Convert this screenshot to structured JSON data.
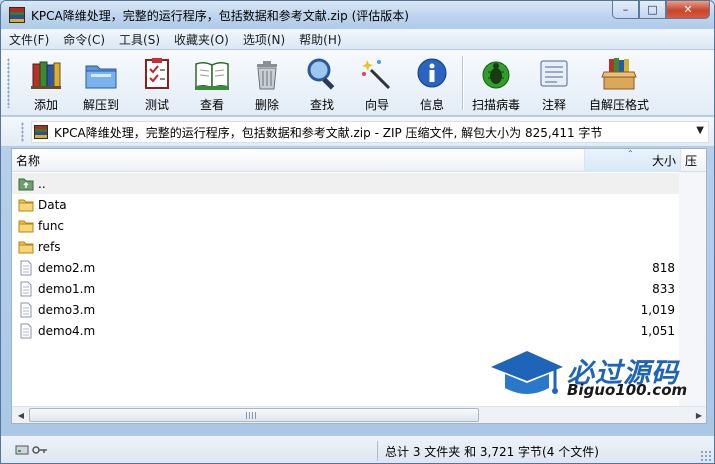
{
  "window": {
    "title": "KPCA降维处理，完整的运行程序，包括数据和参考文献.zip (评估版本)",
    "controls": {
      "minimize": "–",
      "maximize": "□",
      "close": "✕"
    }
  },
  "menu": [
    {
      "id": "file",
      "label": "文件(F)"
    },
    {
      "id": "commands",
      "label": "命令(C)"
    },
    {
      "id": "tools",
      "label": "工具(S)"
    },
    {
      "id": "favorites",
      "label": "收藏夹(O)"
    },
    {
      "id": "options",
      "label": "选项(N)"
    },
    {
      "id": "help",
      "label": "帮助(H)"
    }
  ],
  "toolbar": [
    {
      "id": "add",
      "label": "添加",
      "icon": "books-icon"
    },
    {
      "id": "extract-to",
      "label": "解压到",
      "icon": "folder-extract-icon"
    },
    {
      "id": "test",
      "label": "测试",
      "icon": "checklist-icon"
    },
    {
      "id": "view",
      "label": "查看",
      "icon": "open-book-icon"
    },
    {
      "id": "delete",
      "label": "删除",
      "icon": "trash-icon"
    },
    {
      "id": "find",
      "label": "查找",
      "icon": "magnifier-icon"
    },
    {
      "id": "wizard",
      "label": "向导",
      "icon": "magic-wand-icon"
    },
    {
      "id": "info",
      "label": "信息",
      "icon": "info-icon"
    },
    {
      "id": "virus-scan",
      "label": "扫描病毒",
      "icon": "bug-icon"
    },
    {
      "id": "comment",
      "label": "注释",
      "icon": "comment-icon"
    },
    {
      "id": "sfx",
      "label": "自解压格式",
      "icon": "sfx-box-icon"
    }
  ],
  "address": {
    "text": "KPCA降维处理，完整的运行程序，包括数据和参考文献.zip - ZIP 压缩文件, 解包大小为 825,411 字节",
    "dropdown": "▼"
  },
  "columns": {
    "name": "名称",
    "size": "大小",
    "compressed": "压",
    "sort_arrow": "⌃"
  },
  "files": [
    {
      "name": "..",
      "size": "",
      "type": "parent"
    },
    {
      "name": "Data",
      "size": "",
      "type": "folder"
    },
    {
      "name": "func",
      "size": "",
      "type": "folder"
    },
    {
      "name": "refs",
      "size": "",
      "type": "folder"
    },
    {
      "name": "demo2.m",
      "size": "818",
      "type": "file"
    },
    {
      "name": "demo1.m",
      "size": "833",
      "type": "file"
    },
    {
      "name": "demo3.m",
      "size": "1,019",
      "type": "file"
    },
    {
      "name": "demo4.m",
      "size": "1,051",
      "type": "file"
    }
  ],
  "watermark": {
    "brand": "必过源码",
    "url": "Biguo100.com"
  },
  "status": {
    "summary": "总计 3 文件夹 和 3,721 字节(4 个文件)"
  },
  "scroll": {
    "left_arrow": "◀",
    "right_arrow": "▶"
  },
  "colors": {
    "accent": "#1e64b8",
    "folder": "#f2c14e",
    "selected_row": "#f0f0f0"
  }
}
